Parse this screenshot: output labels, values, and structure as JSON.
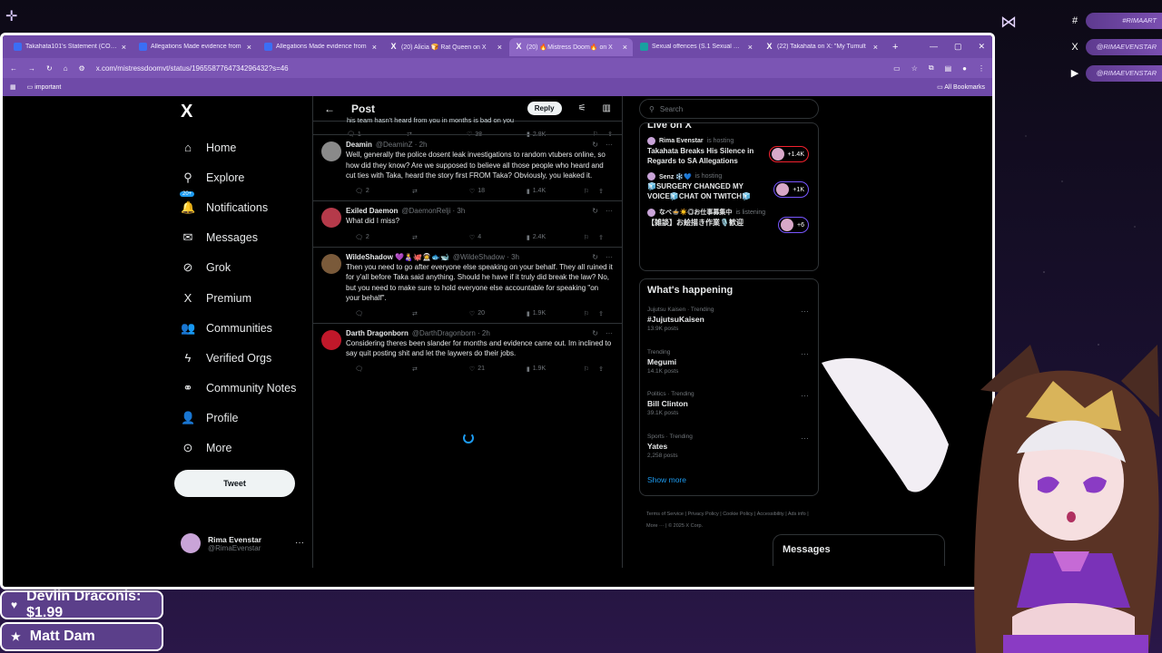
{
  "browser": {
    "tabs": [
      {
        "label": "Takahata101's Statement (COPY)",
        "icon": "doc-icon",
        "active": false
      },
      {
        "label": "Allegations Made evidence from",
        "icon": "doc-icon",
        "active": false
      },
      {
        "label": "Allegations Made evidence from",
        "icon": "doc-icon",
        "active": false
      },
      {
        "label": "(20) Alicia 🍞 Rat Queen on X",
        "icon": "x-icon",
        "active": false
      },
      {
        "label": "(20) 🔥Mistress Doom🔥 on X",
        "icon": "x-icon",
        "active": true
      },
      {
        "label": "Sexual offences (S.1 Sexual Offences",
        "icon": "web-icon",
        "active": false
      },
      {
        "label": "(22) Takahata on X: \"My Tumult",
        "icon": "x-icon",
        "active": false
      }
    ],
    "url": "x.com/mistressdoomvt/status/1965587764734296432?s=46",
    "bookmark": "important",
    "all_bookmarks": "All Bookmarks"
  },
  "nav": {
    "items": [
      {
        "label": "Home",
        "icon": "home-icon",
        "glyph": "⌂"
      },
      {
        "label": "Explore",
        "icon": "search-icon",
        "glyph": "⚲"
      },
      {
        "label": "Notifications",
        "icon": "bell-icon",
        "glyph": "🔔",
        "badge": "20+"
      },
      {
        "label": "Messages",
        "icon": "mail-icon",
        "glyph": "✉"
      },
      {
        "label": "Grok",
        "icon": "grok-icon",
        "glyph": "⊘"
      },
      {
        "label": "Premium",
        "icon": "x-logo-icon",
        "glyph": "X"
      },
      {
        "label": "Communities",
        "icon": "people-icon",
        "glyph": "👥"
      },
      {
        "label": "Verified Orgs",
        "icon": "lightning-icon",
        "glyph": "ϟ"
      },
      {
        "label": "Community Notes",
        "icon": "notes-icon",
        "glyph": "⚭"
      },
      {
        "label": "Profile",
        "icon": "person-icon",
        "glyph": "👤"
      },
      {
        "label": "More",
        "icon": "more-circle-icon",
        "glyph": "⊙"
      }
    ],
    "tweet_label": "Tweet",
    "account": {
      "name": "Rima Evenstar",
      "handle": "@RimaEvenstar"
    }
  },
  "post": {
    "header": "Post",
    "reply_label": "Reply",
    "cut_text": "his team hasn't heard from you in months is bad on you",
    "cut_stats": {
      "replies": "1",
      "likes": "38",
      "views": "2.8K"
    },
    "replies": [
      {
        "name": "Deamin",
        "handle": "@DeaminZ · 2h",
        "text": "Well, generally the police dosent leak investigations to random vtubers online, so how did they know? Are we supposed to believe all those people who heard and cut ties with Taka, heard the story first FROM Taka? Obviously, you leaked it.",
        "replies": "2",
        "retweets": "",
        "likes": "18",
        "views": "1.4K",
        "color": "#8a8a8a"
      },
      {
        "name": "Exiled Daemon",
        "handle": "@DaemonRelji · 3h",
        "text": "What did I miss?",
        "replies": "2",
        "retweets": "",
        "likes": "4",
        "views": "2.4K",
        "color": "#b53a4a"
      },
      {
        "name": "WildeShadow 💜👩‍🍼🐙🧑‍🚀🐟🐋",
        "handle": "@WildeShadow · 3h",
        "text": "Then you need to go after everyone else speaking on your behalf. They all ruined it for y'all before Taka said anything. Should he have if it truly did break the law? No, but you need to make sure to hold everyone else accountable for speaking \"on your behalf\".",
        "replies": "",
        "retweets": "",
        "likes": "20",
        "views": "1.9K",
        "color": "#7a5a3a"
      },
      {
        "name": "Darth Dragonborn",
        "handle": "@DarthDragonborn · 2h",
        "text": "Considering theres been slander for months and evidence came out. Im inclined to say quit posting shit and let the laywers do their jobs.",
        "replies": "",
        "retweets": "",
        "likes": "21",
        "views": "1.9K",
        "color": "#c0182a"
      }
    ]
  },
  "sidebar": {
    "search_placeholder": "Search",
    "live_title": "Live on X",
    "live": [
      {
        "name": "Rima Evenstar",
        "status": "is hosting",
        "title": "Takahata Breaks His Silence in Regards to SA Allegations",
        "count": "+1.4K"
      },
      {
        "name": "Senz ❄️💙",
        "status": "is hosting",
        "title": "🧊SURGERY CHANGED MY VOICE🧊CHAT ON TWITCH🧊",
        "count": "+1K"
      },
      {
        "name": "なべ🍲☀️◎お仕事募集中",
        "status": "is listening",
        "title": "【雑談】お絵描き作業🎙️歓迎",
        "count": "+6"
      }
    ],
    "happening_title": "What's happening",
    "trends": [
      {
        "context": "Jujutsu Kaisen · Trending",
        "name": "#JujutsuKaisen",
        "posts": "13.9K posts"
      },
      {
        "context": "Trending",
        "name": "Megumi",
        "posts": "14.1K posts"
      },
      {
        "context": "Politics · Trending",
        "name": "Bill Clinton",
        "posts": "39.1K posts"
      },
      {
        "context": "Sports · Trending",
        "name": "Yates",
        "posts": "2,258 posts"
      }
    ],
    "show_more": "Show more",
    "footer": [
      "Terms of Service",
      "Privacy Policy",
      "Cookie Policy",
      "Accessibility",
      "Ads info",
      "More ···",
      "© 2025 X Corp."
    ]
  },
  "messages_dock": "Messages",
  "overlay": {
    "socials": [
      {
        "icon": "hashtag-icon",
        "glyph": "#",
        "label": "#RIMAART"
      },
      {
        "icon": "x-social-icon",
        "glyph": "X",
        "label": "@RIMAEVENSTAR"
      },
      {
        "icon": "youtube-icon",
        "glyph": "▶",
        "label": "@RIMAEVENSTAR"
      }
    ],
    "alerts": [
      {
        "icon": "heart-icon",
        "glyph": "♥",
        "text": "Devlin Draconis: $1.99"
      },
      {
        "icon": "star-icon",
        "glyph": "★",
        "text": "Matt Dam"
      }
    ]
  },
  "colors": {
    "accent": "#1d9bf0",
    "browser": "#6f4aa8",
    "live_pill": "#f4212e"
  }
}
